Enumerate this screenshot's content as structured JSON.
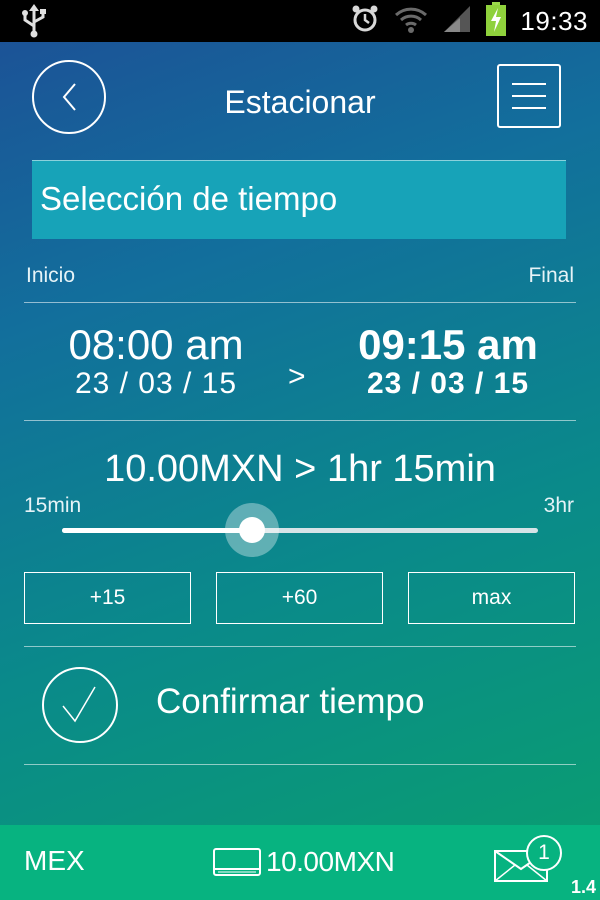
{
  "status_bar": {
    "time": "19:33",
    "icons": [
      "usb-icon",
      "alarm-icon",
      "wifi-icon",
      "signal-icon",
      "battery-charging-icon"
    ]
  },
  "header": {
    "title": "Estacionar",
    "back_icon": "chevron-left-icon",
    "menu_icon": "menu-icon"
  },
  "section": {
    "title": "Selección de tiempo"
  },
  "range_labels": {
    "start": "Inicio",
    "end": "Final"
  },
  "start": {
    "time": "08:00 am",
    "date": "23 / 03 / 15"
  },
  "separator": ">",
  "end": {
    "time": "09:15 am",
    "date": "23 / 03 / 15"
  },
  "summary": {
    "amount": "10.00MXN",
    "arrow": ">",
    "duration": "1hr 15min"
  },
  "slider": {
    "min_label": "15min",
    "max_label": "3hr",
    "value_fraction": 0.4
  },
  "buttons": {
    "plus15": "+15",
    "plus60": "+60",
    "max": "max"
  },
  "confirm": {
    "label": "Confirmar tiempo",
    "icon": "check-icon"
  },
  "bottom_bar": {
    "country": "MEX",
    "balance": "10.00MXN",
    "wallet_icon": "wallet-icon",
    "messages_icon": "envelope-icon",
    "unread_count": "1",
    "version": "1.4"
  },
  "colors": {
    "section_bar": "#17a3b8",
    "bottom_bar": "#07b380",
    "gradient_top": "#1d4f96",
    "gradient_bottom": "#0aa06e"
  }
}
